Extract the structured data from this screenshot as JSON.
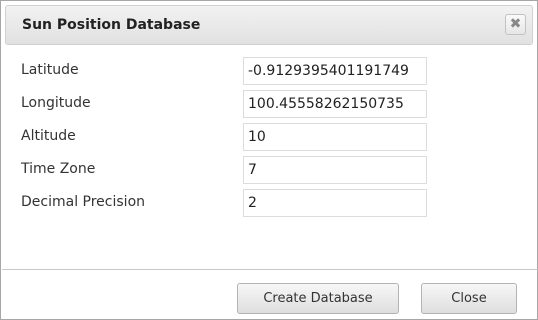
{
  "dialog": {
    "title": "Sun Position Database",
    "close_glyph": "✖"
  },
  "fields": [
    {
      "label": "Latitude",
      "value": "-0.9129395401191749"
    },
    {
      "label": "Longitude",
      "value": "100.45558262150735"
    },
    {
      "label": "Altitude",
      "value": "10"
    },
    {
      "label": "Time Zone",
      "value": "7"
    },
    {
      "label": "Decimal Precision",
      "value": "2"
    }
  ],
  "buttons": {
    "create_label": "Create Database",
    "close_label": "Close"
  }
}
